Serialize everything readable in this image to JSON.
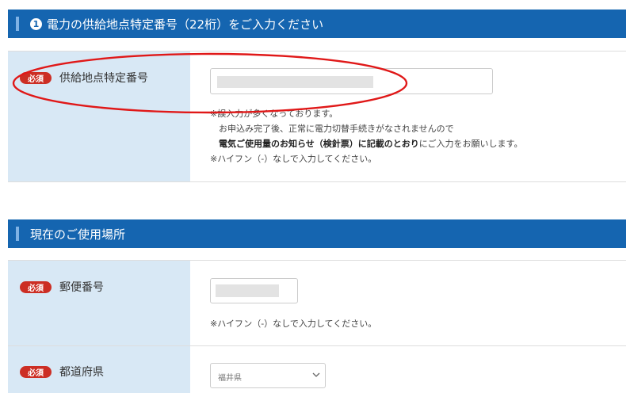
{
  "section1": {
    "number": "1",
    "title": "電力の供給地点特定番号（22桁）をご入力ください",
    "field": {
      "required_badge": "必須",
      "label": "供給地点特定番号",
      "value": "",
      "notes": {
        "line1": "※誤入力が多くなっております。",
        "line2": "お申込み完了後、正常に電力切替手続きがなされませんので",
        "line3_bold": "電気ご使用量のお知らせ（検針票）に記載のとおり",
        "line3_rest": "にご入力をお願いします。",
        "line4": "※ハイフン（-）なしで入力してください。"
      }
    }
  },
  "section2": {
    "title": "現在のご使用場所",
    "postal": {
      "required_badge": "必須",
      "label": "郵便番号",
      "value": "",
      "note": "※ハイフン（-）なしで入力してください。"
    },
    "prefecture": {
      "required_badge": "必須",
      "label": "都道府県",
      "selected": "福井県"
    }
  },
  "colors": {
    "header_bg": "#1565b0",
    "label_bg": "#d8e8f5",
    "required_badge": "#cc2e24",
    "annotation_ellipse": "#e01818"
  },
  "icons": {
    "header_bar": "vertical-bar",
    "number_circle": "circled-number",
    "select_arrow": "chevron-down-icon"
  }
}
